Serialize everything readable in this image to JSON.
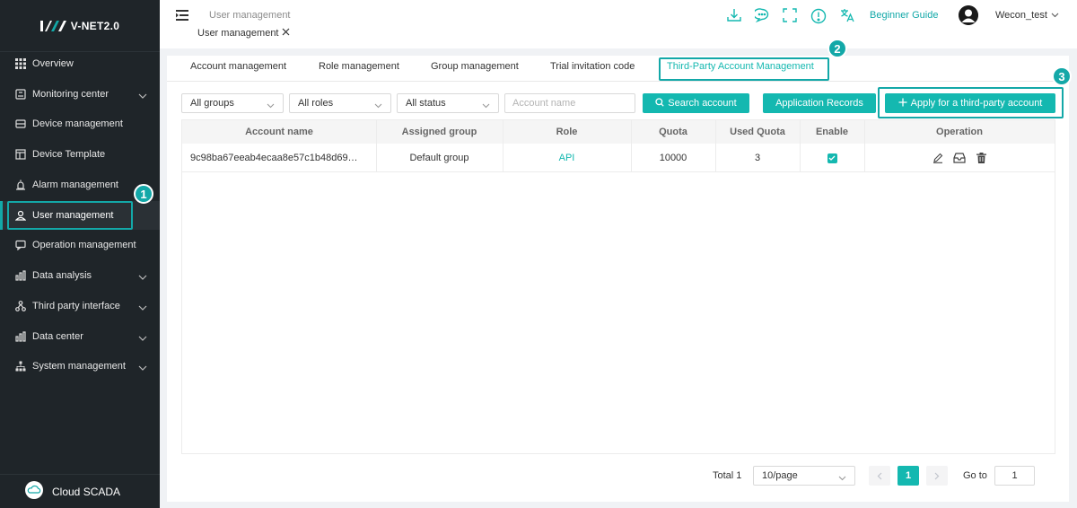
{
  "app": {
    "logo_text": "V-NET2.0"
  },
  "sidebar": {
    "items": [
      {
        "label": "Overview",
        "icon": "grid-icon",
        "has_chevron": false
      },
      {
        "label": "Monitoring center",
        "icon": "monitor-icon",
        "has_chevron": true
      },
      {
        "label": "Device management",
        "icon": "device-icon",
        "has_chevron": false
      },
      {
        "label": "Device Template",
        "icon": "template-icon",
        "has_chevron": false
      },
      {
        "label": "Alarm management",
        "icon": "alarm-icon",
        "has_chevron": true
      },
      {
        "label": "User management",
        "icon": "user-icon",
        "has_chevron": false,
        "active": true
      },
      {
        "label": "Operation management",
        "icon": "chat-icon",
        "has_chevron": false
      },
      {
        "label": "Data analysis",
        "icon": "bar-chart-icon",
        "has_chevron": true
      },
      {
        "label": "Third party interface",
        "icon": "network-icon",
        "has_chevron": true
      },
      {
        "label": "Data center",
        "icon": "bar-chart-icon",
        "has_chevron": true
      },
      {
        "label": "System management",
        "icon": "hierarchy-icon",
        "has_chevron": true
      }
    ],
    "footer": {
      "label": "Cloud SCADA",
      "icon": "cloud-icon"
    }
  },
  "badges": [
    "1",
    "2",
    "3"
  ],
  "header": {
    "breadcrumb": "User management",
    "open_tab": "User management",
    "guide": "Beginner Guide",
    "username": "Wecon_test",
    "icons": [
      "download-icon",
      "message-icon",
      "fullscreen-icon",
      "info-icon",
      "translate-icon"
    ]
  },
  "tabs": [
    "Account management",
    "Role management",
    "Group management",
    "Trial invitation code",
    "Third-Party Account Management"
  ],
  "filters": {
    "group": "All groups",
    "role": "All roles",
    "status": "All status",
    "account_placeholder": "Account name"
  },
  "buttons": {
    "search": "Search account",
    "records": "Application Records",
    "apply": "Apply for a third-party account"
  },
  "table": {
    "headers": [
      "Account name",
      "Assigned group",
      "Role",
      "Quota",
      "Used Quota",
      "Enable",
      "Operation"
    ],
    "rows": [
      {
        "account": "9c98ba67eeab4ecaa8e57c1b48d69…",
        "group": "Default group",
        "role": "API",
        "quota": "10000",
        "used": "3",
        "enabled": true
      }
    ]
  },
  "pagination": {
    "total": "Total 1",
    "page_size": "10/page",
    "current": "1",
    "goto_label": "Go to",
    "goto_value": "1"
  },
  "colors": {
    "accent": "#14b8b0",
    "sidebar": "#1f2529"
  }
}
